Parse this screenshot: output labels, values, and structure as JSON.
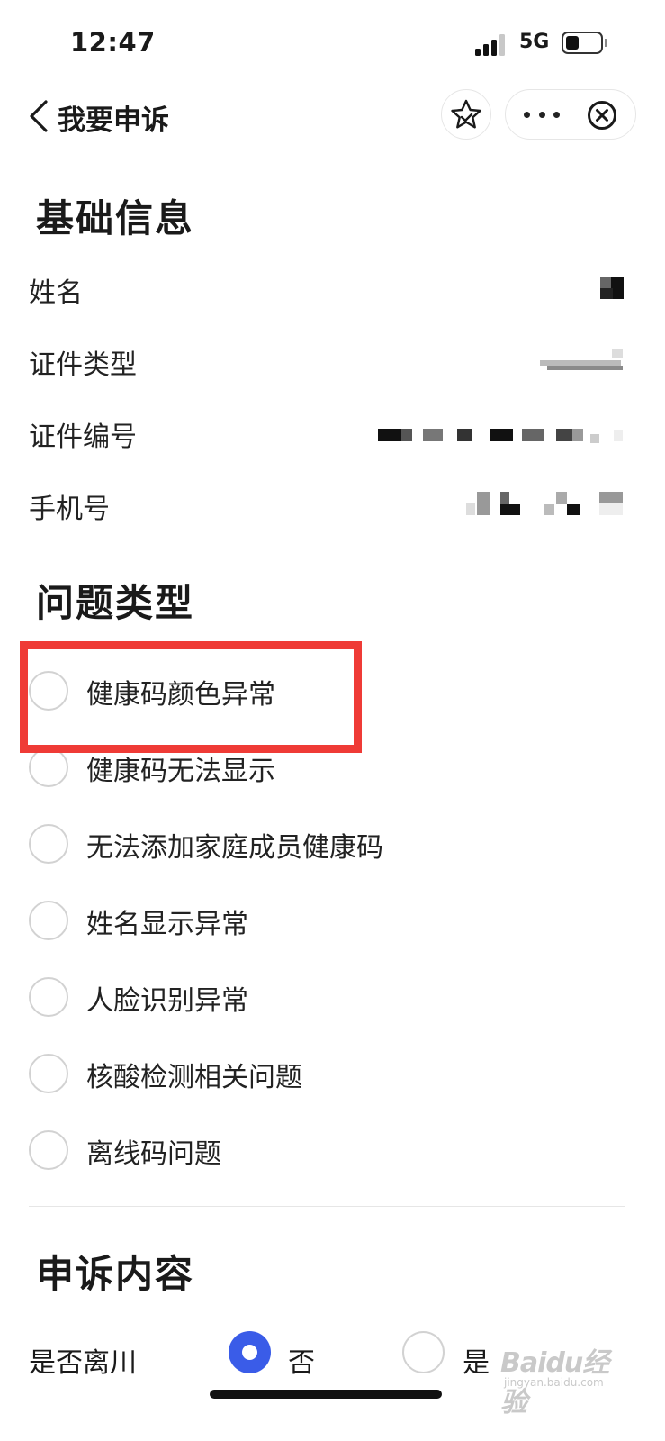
{
  "status_bar": {
    "time": "12:47",
    "network": "5G"
  },
  "nav": {
    "title": "我要申诉"
  },
  "basic_info": {
    "title": "基础信息",
    "rows": [
      {
        "label": "姓名"
      },
      {
        "label": "证件类型"
      },
      {
        "label": "证件编号"
      },
      {
        "label": "手机号"
      }
    ]
  },
  "problem_type": {
    "title": "问题类型",
    "options": [
      {
        "label": "健康码颜色异常"
      },
      {
        "label": "健康码无法显示"
      },
      {
        "label": "无法添加家庭成员健康码"
      },
      {
        "label": "姓名显示异常"
      },
      {
        "label": "人脸识别异常"
      },
      {
        "label": "核酸检测相关问题"
      },
      {
        "label": "离线码问题"
      }
    ]
  },
  "appeal": {
    "title": "申诉内容",
    "left_sichuan": {
      "label": "是否离川",
      "no": "否",
      "yes": "是",
      "selected": "否"
    }
  },
  "watermark": {
    "brand": "Baidu经验",
    "url": "jingyan.baidu.com"
  },
  "colors": {
    "accent": "#3a5ce8",
    "highlight": "#ef3b36"
  }
}
